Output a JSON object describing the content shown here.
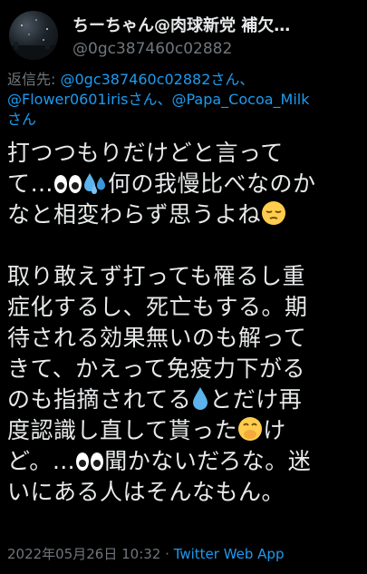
{
  "author": {
    "display_name": "ちーちゃん@肉球新党 補欠…",
    "handle": "@0gc387460c02882"
  },
  "reply_context": {
    "prefix": "返信先: ",
    "mentions": [
      "@0gc387460c02882さん、",
      "@Flower0601irisさん、",
      "@Papa_Cocoa_Milk",
      "さん"
    ]
  },
  "tweet": {
    "lines": [
      "打つつもりだけどと言って",
      "て…",
      "何の我慢比べなのか",
      "なと相変わらず思うよね",
      "",
      "取り敢えず打っても罹るし重",
      "症化するし、死亡もする。期",
      "待される効果無いのも解って",
      "きて、かえって免疫力下がる",
      "のも指摘されてる",
      "とだけ再",
      "度認識し直して貰った",
      "け",
      "ど。…",
      "聞かないだろな。迷",
      "いにある人はそんなもん。"
    ],
    "emoji": {
      "eyes": "eyes-emoji",
      "sweat": "sweat-droplets-emoji",
      "pensive": "pensive-face-emoji",
      "droplet": "droplet-emoji",
      "hand_over_mouth": "face-with-hand-over-mouth-emoji"
    }
  },
  "meta": {
    "timestamp": "2022年05月26日 10:32",
    "separator": " · ",
    "client": "Twitter Web App"
  },
  "colors": {
    "background": "#000000",
    "text": "#e7e9ea",
    "secondary": "#71767b",
    "link": "#1d9bf0"
  }
}
